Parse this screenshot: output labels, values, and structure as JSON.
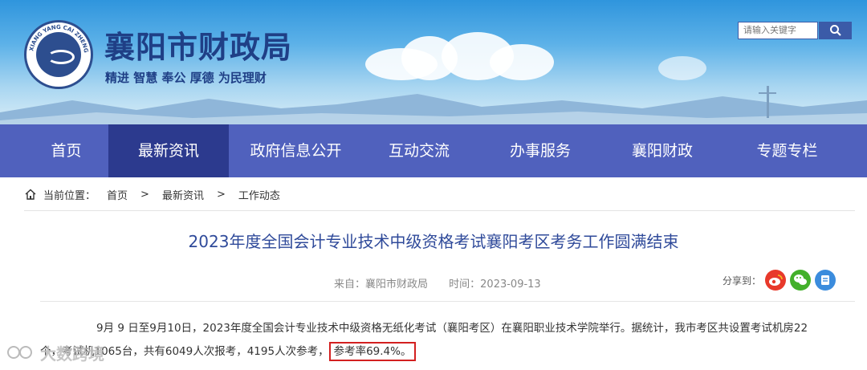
{
  "header": {
    "site_title": "襄阳市财政局",
    "slogan": "精进 智慧 奉公 厚德 为民理财",
    "logo_ring_text": "XIANG YANG CAI ZHENG",
    "search_placeholder": "请输入关键字",
    "brand_color": "#1f3f86"
  },
  "nav": {
    "items": [
      {
        "label": "首页"
      },
      {
        "label": "最新资讯"
      },
      {
        "label": "政府信息公开"
      },
      {
        "label": "互动交流"
      },
      {
        "label": "办事服务"
      },
      {
        "label": "襄阳财政"
      },
      {
        "label": "专题专栏"
      }
    ],
    "active": "最新资讯",
    "bg_color": "#5061bd",
    "active_color": "#2c3a8e"
  },
  "breadcrumb": {
    "label": "当前位置：",
    "items": [
      "首页",
      "最新资讯",
      "工作动态"
    ],
    "separator": ">"
  },
  "article": {
    "title": "2023年度全国会计专业技术中级资格考试襄阳考区考务工作圆满结束",
    "source": "来自：襄阳市财政局",
    "time": "时间：2023-09-13",
    "share_label": "分享到：",
    "share_targets": [
      "weibo-icon",
      "wechat-icon",
      "qzone-icon"
    ],
    "para1": "9月 9 日至9月10日，2023年度全国会计专业技术中级资格无纸化考试（襄阳考区）在襄阳职业技术学院举行。据统计，我市考区共设置考试机房22",
    "para2_prefix": "个，考试机1065台，共有6049人次报考，4195人次参考，",
    "para2_highlight": "参考率69.4%。"
  },
  "watermark": {
    "text": "大数跨境"
  }
}
